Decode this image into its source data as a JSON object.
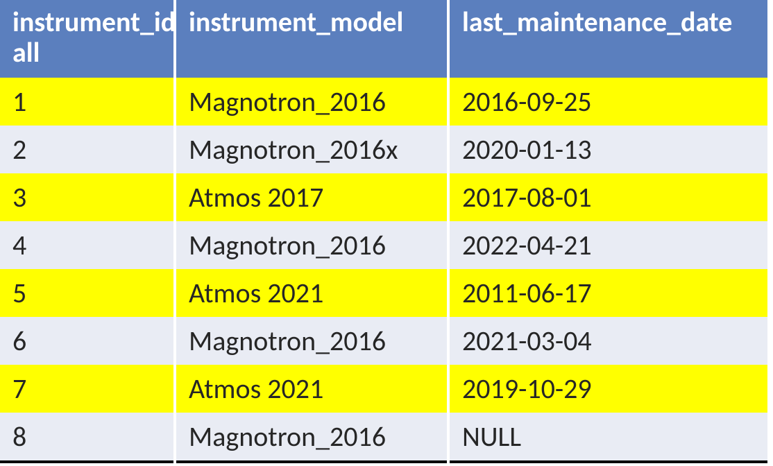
{
  "table": {
    "headers": {
      "col0": "instrument_id all",
      "col1": "instrument_model",
      "col2": "last_maintenance_date"
    },
    "rows": [
      {
        "id": "1",
        "model": "Magnotron_2016",
        "date": "2016-09-25",
        "highlight": true
      },
      {
        "id": "2",
        "model": "Magnotron_2016x",
        "date": "2020-01-13",
        "highlight": false
      },
      {
        "id": "3",
        "model": "Atmos 2017",
        "date": "2017-08-01",
        "highlight": true
      },
      {
        "id": "4",
        "model": "Magnotron_2016",
        "date": "2022-04-21",
        "highlight": false
      },
      {
        "id": "5",
        "model": "Atmos 2021",
        "date": "2011-06-17",
        "highlight": true
      },
      {
        "id": "6",
        "model": "Magnotron_2016",
        "date": "2021-03-04",
        "highlight": false
      },
      {
        "id": "7",
        "model": "Atmos 2021",
        "date": "2019-10-29",
        "highlight": true
      },
      {
        "id": "8",
        "model": "Magnotron_2016",
        "date": "NULL",
        "highlight": false
      }
    ]
  }
}
